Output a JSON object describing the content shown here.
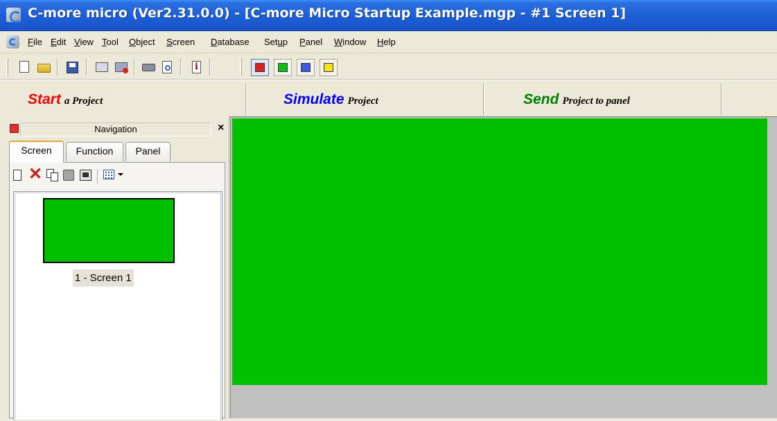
{
  "window": {
    "title": "C-more micro (Ver2.31.0.0) - [C-more Micro Startup Example.mgp - #1 Screen 1]"
  },
  "menu": {
    "items": [
      {
        "label": "File",
        "accel": "F"
      },
      {
        "label": "Edit",
        "accel": "E"
      },
      {
        "label": "View",
        "accel": "V"
      },
      {
        "label": "Tool",
        "accel": "T"
      },
      {
        "label": "Object",
        "accel": "O"
      },
      {
        "label": "Screen",
        "accel": "S"
      },
      {
        "label": "Database",
        "accel": "D"
      },
      {
        "label": "Setup",
        "accel": "u"
      },
      {
        "label": "Panel",
        "accel": "P"
      },
      {
        "label": "Window",
        "accel": "W"
      },
      {
        "label": "Help",
        "accel": "H"
      }
    ]
  },
  "toolbar": {
    "icons": [
      "new-icon",
      "open-icon",
      "save-icon",
      "check-icon",
      "erase-icon",
      "print-icon",
      "print-preview-icon",
      "info-icon"
    ],
    "color_buttons": [
      {
        "name": "red",
        "color": "#e02020",
        "selected": true
      },
      {
        "name": "green",
        "color": "#10c010",
        "selected": false
      },
      {
        "name": "blue",
        "color": "#3a5ce0",
        "selected": false
      },
      {
        "name": "yellow",
        "color": "#f2e21a",
        "selected": false
      }
    ]
  },
  "actions": {
    "start": {
      "big": "Start",
      "small": "a Project",
      "color": "#ff0000"
    },
    "simulate": {
      "big": "Simulate",
      "small": "Project",
      "color": "#0000ff"
    },
    "send": {
      "big": "Send",
      "small": "Project to panel",
      "color": "#008000"
    }
  },
  "navigation": {
    "title": "Navigation",
    "close": "×",
    "indicator_color": "#e03030",
    "tabs": [
      {
        "label": "Screen",
        "active": true
      },
      {
        "label": "Function",
        "active": false
      },
      {
        "label": "Panel",
        "active": false
      }
    ],
    "toolbar_icons": [
      "new-screen-icon",
      "delete-icon",
      "copy-icon",
      "paste-icon",
      "properties-icon",
      "view-grid-icon",
      "dropdown-arrow-icon"
    ],
    "screens": [
      {
        "label": "1 - Screen 1",
        "background": "#00c000"
      }
    ]
  },
  "workspace": {
    "screen_background": "#00c000",
    "backdrop": "#c0c0c0"
  }
}
